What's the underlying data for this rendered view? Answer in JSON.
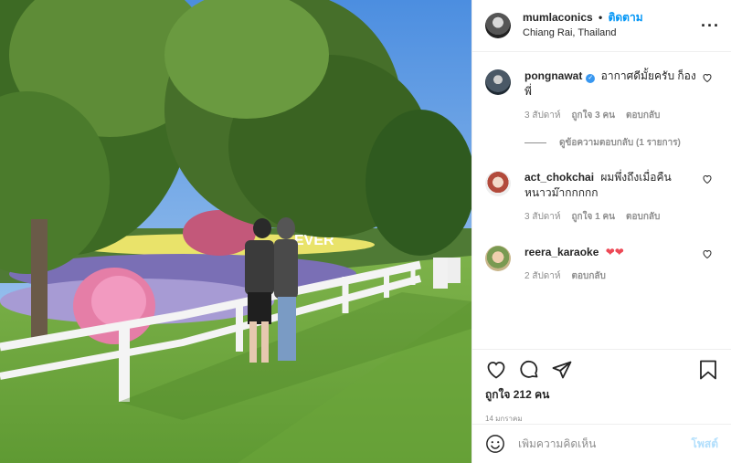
{
  "header": {
    "username": "mumlaconics",
    "separator": "•",
    "follow_label": "ติดตาม",
    "location": "Chiang Rai, Thailand",
    "more_label": "···"
  },
  "photo": {
    "sign_text": "EVER"
  },
  "comments": [
    {
      "username": "pongnawat",
      "verified": true,
      "text": "อากาศดีมั้ยครับ ก็องพี่",
      "time": "3 สัปดาห์",
      "likes": "ถูกใจ 3 คน",
      "reply_label": "ตอบกลับ",
      "view_replies": "ดูข้อความตอบกลับ (1 รายการ)"
    },
    {
      "username": "act_chokchai",
      "text": "ผมพึ่งถึงเมื่อคืน หนาวม๊ากกกกก",
      "time": "3 สัปดาห์",
      "likes": "ถูกใจ 1 คน",
      "reply_label": "ตอบกลับ"
    },
    {
      "username": "reera_karaoke",
      "text": "❤❤",
      "time": "2 สัปดาห์",
      "reply_label": "ตอบกลับ"
    }
  ],
  "actions": {
    "likes_text": "ถูกใจ 212 คน",
    "date": "14 มกราคม"
  },
  "add_comment": {
    "placeholder": "เพิ่มความคิดเห็น",
    "post_label": "โพสต์"
  },
  "colors": {
    "accent": "#0095f6",
    "heart_red": "#ed4956",
    "muted": "#8e8e8e"
  }
}
